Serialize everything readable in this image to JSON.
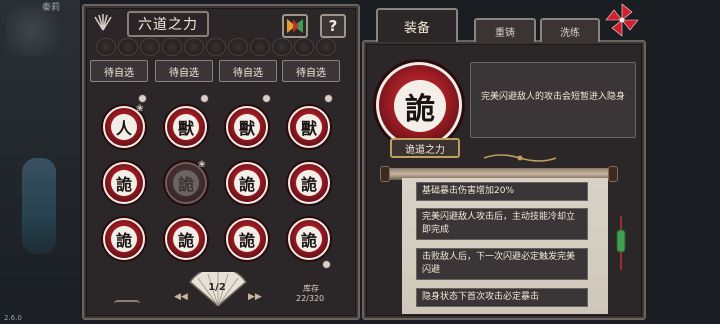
{
  "background": {
    "npc_name": "秦莉",
    "version": "2.6.0"
  },
  "left_panel": {
    "title": "六道之力",
    "help_label": "?",
    "slots": [
      "待自选",
      "待自选",
      "待自选",
      "待自选"
    ],
    "medals": [
      {
        "char": "人",
        "dimmed": false
      },
      {
        "char": "獸",
        "dimmed": false
      },
      {
        "char": "獸",
        "dimmed": false
      },
      {
        "char": "獸",
        "dimmed": false
      },
      {
        "char": "詭",
        "dimmed": false
      },
      {
        "char": "詭",
        "dimmed": true
      },
      {
        "char": "詭",
        "dimmed": false
      },
      {
        "char": "詭",
        "dimmed": false
      },
      {
        "char": "詭",
        "dimmed": false
      },
      {
        "char": "詭",
        "dimmed": false
      },
      {
        "char": "詭",
        "dimmed": false
      },
      {
        "char": "詭",
        "dimmed": false
      }
    ],
    "page_indicator": "1/2",
    "store_label": "库存",
    "store_count": "22/320"
  },
  "right_panel": {
    "tabs": {
      "equip": "装备",
      "recast": "重铸",
      "wash": "洗练"
    },
    "selected": {
      "char": "詭",
      "name": "诡道之力",
      "description": "完美闪避敌人的攻击会短暂进入隐身"
    },
    "affixes": [
      "基础暴击伤害增加20%",
      "完美闪避敌人攻击后，主动技能冷却立即完成",
      "击败敌人后，下一次闪避必定触发完美闪避",
      "隐身状态下首次攻击必定暴击"
    ]
  },
  "colors": {
    "panel_bg": "#2b2627",
    "medal_red": "#c0272d",
    "scroll_paper": "#d8d2c6",
    "accent_gold": "#c0a060"
  }
}
